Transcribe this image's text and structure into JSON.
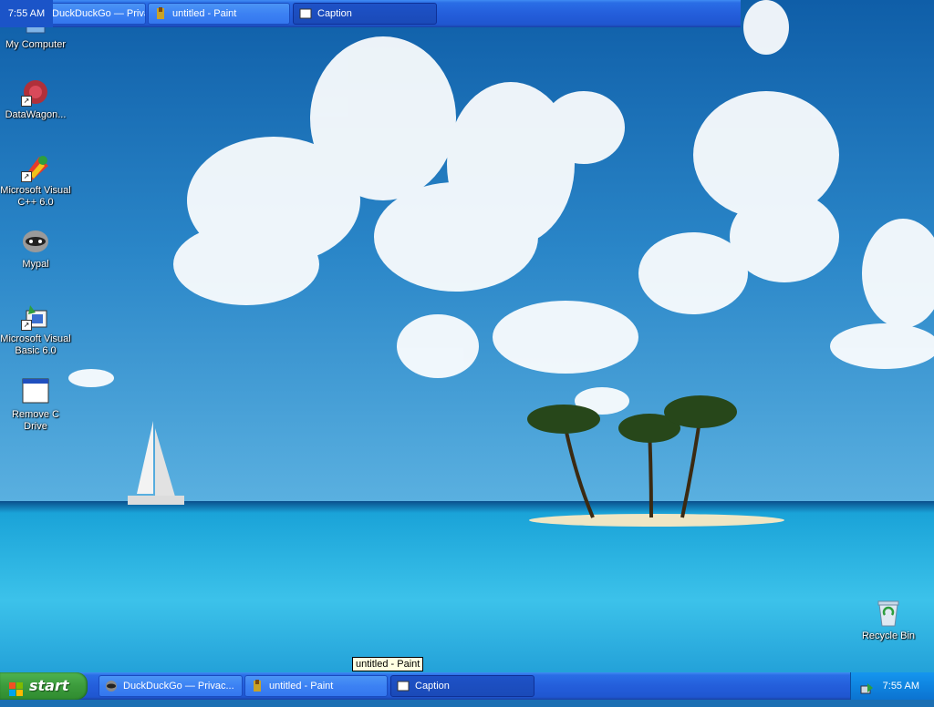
{
  "desktop": {
    "icons": [
      {
        "label": "My Computer"
      },
      {
        "label": "DataWagon..."
      },
      {
        "label": "Microsoft Visual C++ 6.0"
      },
      {
        "label": "Mypal"
      },
      {
        "label": "Microsoft Visual Basic 6.0"
      },
      {
        "label": "Remove C Drive"
      },
      {
        "label": "Recycle Bin"
      }
    ]
  },
  "top_taskbar": {
    "clock": "7:55 AM",
    "buttons": [
      {
        "label": "DuckDuckGo — Privac...",
        "icon": "duckduckgo-icon"
      },
      {
        "label": "untitled - Paint",
        "icon": "paint-icon"
      },
      {
        "label": "Caption",
        "icon": "window-icon"
      }
    ]
  },
  "taskbar": {
    "start_label": "start",
    "buttons": [
      {
        "label": "DuckDuckGo — Privac...",
        "icon": "duckduckgo-icon"
      },
      {
        "label": "untitled - Paint",
        "icon": "paint-icon"
      },
      {
        "label": "Caption",
        "icon": "window-icon"
      }
    ],
    "clock": "7:55 AM"
  },
  "tooltip": "untitled - Paint",
  "colors": {
    "taskbar": "#245edb",
    "start": "#3c9b3c",
    "tray": "#0f84e0",
    "sky": "#1b6fb3",
    "sea": "#2fb8e6"
  }
}
